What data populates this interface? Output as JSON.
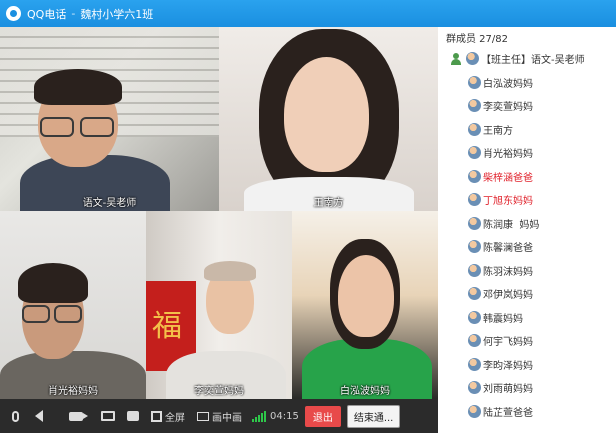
{
  "window": {
    "app_name": "QQ电话",
    "separator": "-",
    "group_name": "魏村小学六1班"
  },
  "videos": [
    {
      "name": "语文-吴老师"
    },
    {
      "name": "王南方"
    },
    {
      "name": "肖光裕妈妈"
    },
    {
      "name": "李奕萱妈妈"
    },
    {
      "name": "白泓波妈妈"
    }
  ],
  "banner_char": "福",
  "toolbar": {
    "fullscreen_label": "全屏",
    "pip_label": "画中画",
    "call_time": "04:15",
    "exit_label": "退出",
    "end_label": "结束通..."
  },
  "members_panel": {
    "header": "群成员 27/82",
    "items": [
      {
        "label": "【班主任】语文-吴老师",
        "color": "normal"
      },
      {
        "label": "白泓波妈妈",
        "color": "normal"
      },
      {
        "label": "李奕萱妈妈",
        "color": "normal"
      },
      {
        "label": "王南方",
        "color": "normal"
      },
      {
        "label": "肖光裕妈妈",
        "color": "normal"
      },
      {
        "label": "柴梓涵爸爸",
        "color": "red"
      },
      {
        "label": "丁旭东妈妈",
        "color": "red"
      },
      {
        "label": "陈润康  妈妈",
        "color": "normal"
      },
      {
        "label": "陈馨澜爸爸",
        "color": "normal"
      },
      {
        "label": "陈羽沫妈妈",
        "color": "normal"
      },
      {
        "label": "邓伊岚妈妈",
        "color": "normal"
      },
      {
        "label": "韩震妈妈",
        "color": "normal"
      },
      {
        "label": "何宇飞妈妈",
        "color": "normal"
      },
      {
        "label": "李昀泽妈妈",
        "color": "normal"
      },
      {
        "label": "刘雨萌妈妈",
        "color": "normal"
      },
      {
        "label": "陆芷萱爸爸",
        "color": "normal"
      }
    ]
  },
  "colors": {
    "titlebar": "#1a8fe0",
    "exit_button": "#e84a4a",
    "red_name": "#e0202a",
    "signal": "#2ec84a"
  }
}
